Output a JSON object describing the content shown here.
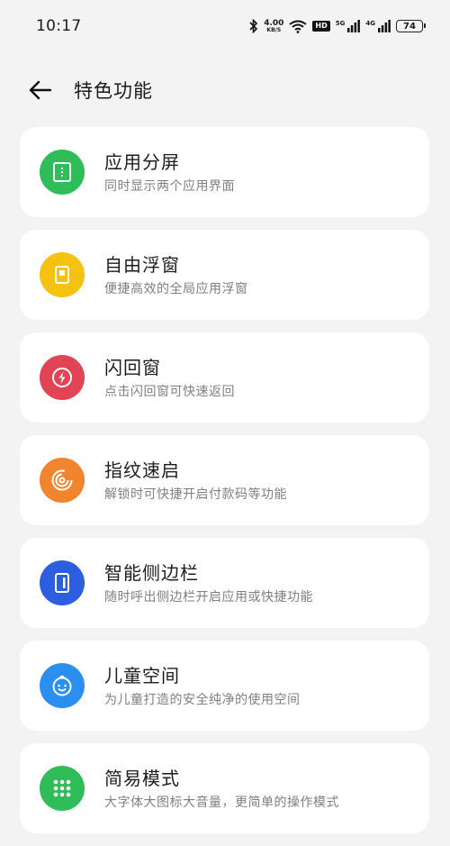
{
  "status_bar": {
    "time": "10:17",
    "net_speed_value": "4.00",
    "net_speed_unit": "KB/S",
    "hd_label": "HD",
    "sim1_gen": "5G",
    "sim2_gen": "4G",
    "battery_level": "74"
  },
  "header": {
    "title": "特色功能"
  },
  "features": [
    {
      "title": "应用分屏",
      "subtitle": "同时显示两个应用界面",
      "icon": "split-screen-icon",
      "color": "#2fbd59"
    },
    {
      "title": "自由浮窗",
      "subtitle": "便捷高效的全局应用浮窗",
      "icon": "floating-window-icon",
      "color": "#f5c211"
    },
    {
      "title": "闪回窗",
      "subtitle": "点击闪回窗可快速返回",
      "icon": "flashback-icon",
      "color": "#e04455"
    },
    {
      "title": "指纹速启",
      "subtitle": "解锁时可快捷开启付款码等功能",
      "icon": "fingerprint-icon",
      "color": "#f0852d"
    },
    {
      "title": "智能侧边栏",
      "subtitle": "随时呼出侧边栏开启应用或快捷功能",
      "icon": "sidebar-icon",
      "color": "#2b5fe0"
    },
    {
      "title": "儿童空间",
      "subtitle": "为儿童打造的安全纯净的使用空间",
      "icon": "kid-face-icon",
      "color": "#2b8ff0"
    },
    {
      "title": "简易模式",
      "subtitle": "大字体大图标大音量，更简单的操作模式",
      "icon": "grid-dots-icon",
      "color": "#2fbd59"
    }
  ]
}
